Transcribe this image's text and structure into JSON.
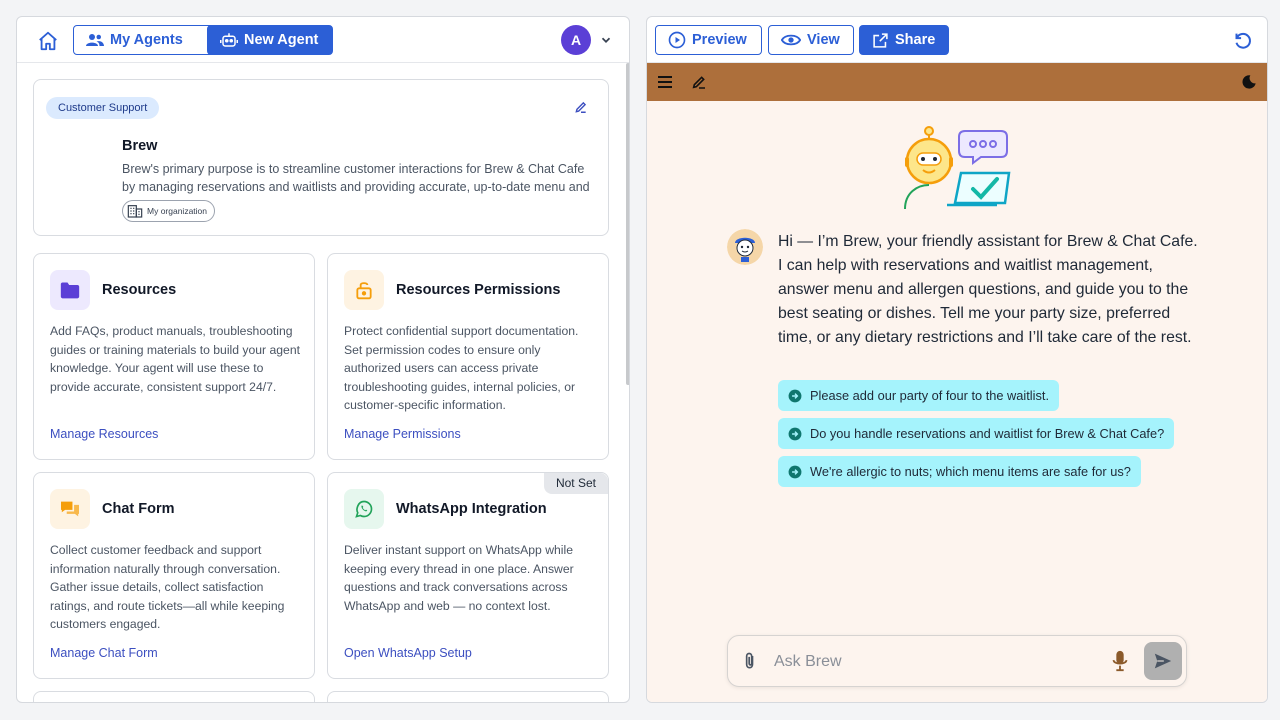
{
  "left": {
    "toolbar": {
      "my_agents": "My Agents",
      "new_agent": "New Agent",
      "avatar_letter": "A"
    },
    "agent": {
      "tag": "Customer Support",
      "name": "Brew",
      "description": "Brew's primary purpose is to streamline customer interactions for Brew & Chat Cafe by managing reservations and waitlists and providing accurate, up-to-date menu and allergen information.",
      "visibility": "My organization"
    },
    "cards": [
      {
        "title": "Resources",
        "description": "Add FAQs, product manuals, troubleshooting guides or training materials to build your agent knowledge. Your agent will use these to provide accurate, consistent support 24/7.",
        "link": "Manage Resources"
      },
      {
        "title": "Resources Permissions",
        "description": "Protect confidential support documentation. Set permission codes to ensure only authorized users can access private troubleshooting guides, internal policies, or customer-specific information.",
        "link": "Manage Permissions"
      },
      {
        "title": "Chat Form",
        "description": "Collect customer feedback and support information naturally through conversation. Gather issue details, collect satisfaction ratings, and route tickets—all while keeping customers engaged.",
        "link": "Manage Chat Form"
      },
      {
        "title": "WhatsApp Integration",
        "badge": "Not Set",
        "description": "Deliver instant support on WhatsApp while keeping every thread in one place. Answer questions and track conversations across WhatsApp and web — no context lost.",
        "link": "Open WhatsApp Setup"
      }
    ]
  },
  "right": {
    "toolbar": {
      "preview": "Preview",
      "view": "View",
      "share": "Share"
    },
    "chat": {
      "greeting": "Hi — I’m Brew, your friendly assistant for Brew & Chat Cafe. I can help with reservations and waitlist management, answer menu and allergen questions, and guide you to the best seating or dishes. Tell me your party size, preferred time, or any dietary restrictions and I’ll take care of the rest.",
      "suggestions": [
        "Please add our party of four to the waitlist.",
        "Do you handle reservations and waitlist for Brew & Chat Cafe?",
        "We're allergic to nuts; which menu items are safe for us?"
      ],
      "input_placeholder": "Ask Brew"
    }
  },
  "colors": {
    "primary": "#2c5fd6",
    "chat_header": "#ad6f3b",
    "chat_bg": "#fdf4ee",
    "chip": "#a5f3fc"
  }
}
